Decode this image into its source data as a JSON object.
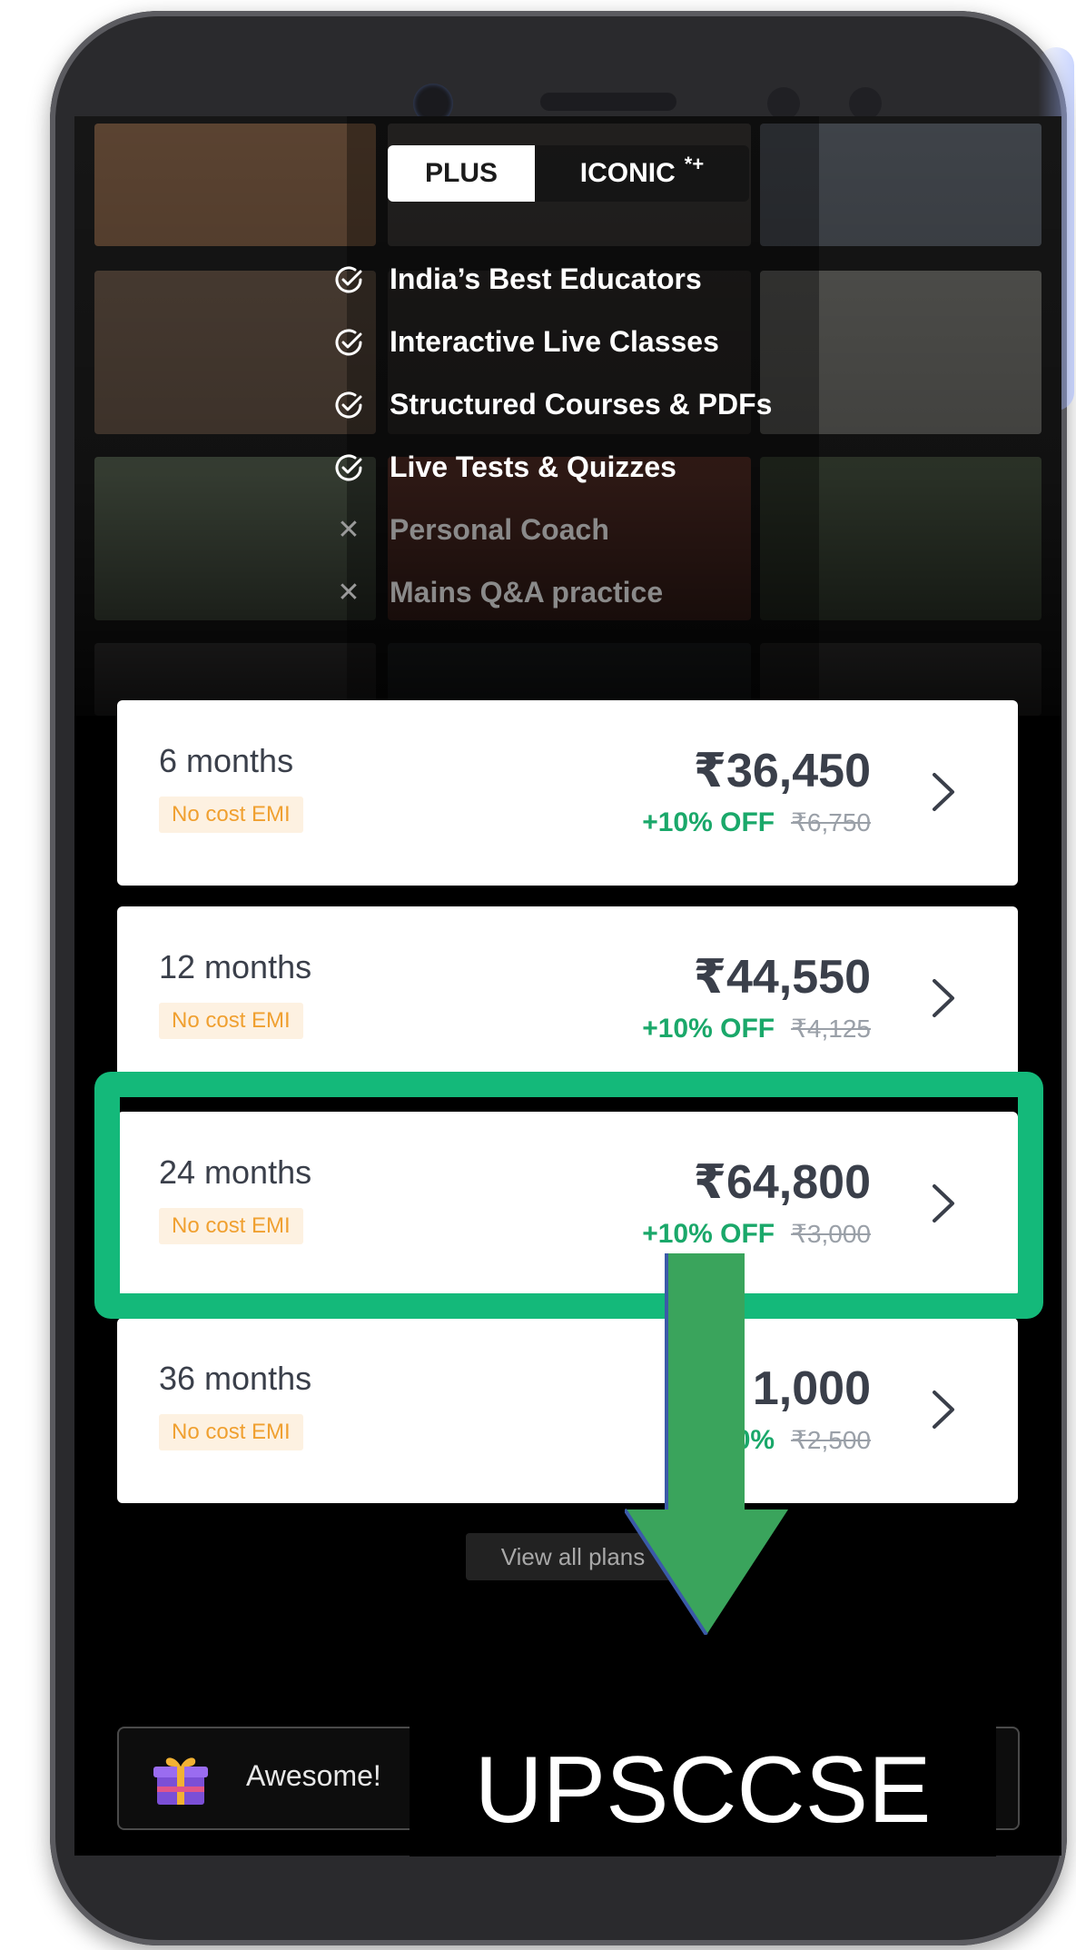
{
  "tabs": {
    "plus_label": "PLUS",
    "iconic_label": "ICONIC",
    "iconic_sparkle": "*+"
  },
  "features": [
    {
      "label": "India’s Best Educators",
      "included": true
    },
    {
      "label": "Interactive Live Classes",
      "included": true
    },
    {
      "label": "Structured Courses & PDFs",
      "included": true
    },
    {
      "label": "Live Tests & Quizzes",
      "included": true
    },
    {
      "label": "Personal Coach",
      "included": false
    },
    {
      "label": "Mains Q&A practice",
      "included": false
    }
  ],
  "plans": [
    {
      "duration": "6 months",
      "emi": "No cost EMI",
      "price": "₹36,450",
      "discount": "+10% OFF",
      "original": "₹6,750"
    },
    {
      "duration": "12 months",
      "emi": "No cost EMI",
      "price": "₹44,550",
      "discount": "+10% OFF",
      "original": "₹4,125"
    },
    {
      "duration": "24 months",
      "emi": "No cost EMI",
      "price": "₹64,800",
      "discount": "+10% OFF",
      "original": "₹3,000"
    },
    {
      "duration": "36 months",
      "emi": "No cost EMI",
      "price": "1,000",
      "discount": "+10%",
      "original": "₹2,500"
    }
  ],
  "view_all_label": "View all plans",
  "toast": {
    "message": "Awesome!"
  },
  "overlay_label": "UPSCCSE",
  "colors": {
    "highlight": "#14b97a",
    "discount_green": "#1aa86a",
    "emi_text": "#f0a030",
    "emi_bg": "#fdf1e1",
    "arrow": "#3aa45c"
  },
  "icons": {
    "included": "check-circle-icon",
    "excluded": "close-icon",
    "plan_chevron": "chevron-right-icon",
    "toast": "gift-icon",
    "annotation": "arrow-down-icon"
  }
}
